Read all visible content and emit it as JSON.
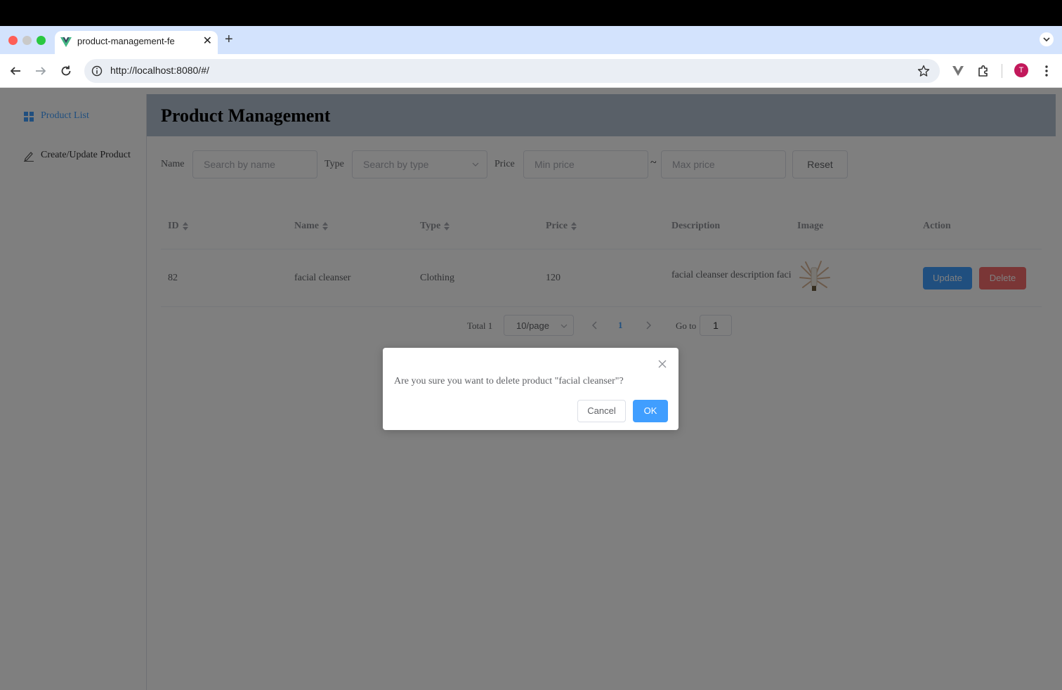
{
  "browser": {
    "tab_title": "product-management-fe",
    "url": "http://localhost:8080/#/",
    "profile_initial": "T"
  },
  "sidebar": {
    "items": [
      {
        "label": "Product List",
        "icon": "grid-icon",
        "active": true
      },
      {
        "label": "Create/Update Product",
        "icon": "edit-icon",
        "active": false
      }
    ]
  },
  "header": {
    "title": "Product Management"
  },
  "filters": {
    "name_label": "Name",
    "name_placeholder": "Search by name",
    "type_label": "Type",
    "type_placeholder": "Search by type",
    "price_label": "Price",
    "min_price_placeholder": "Min price",
    "price_separator": "~",
    "max_price_placeholder": "Max price",
    "reset_label": "Reset"
  },
  "table": {
    "columns": [
      "ID",
      "Name",
      "Type",
      "Price",
      "Description",
      "Image",
      "Action"
    ],
    "rows": [
      {
        "id": "82",
        "name": "facial cleanser",
        "type": "Clothing",
        "price": "120",
        "description": "facial cleanser description faci",
        "update_label": "Update",
        "delete_label": "Delete"
      }
    ]
  },
  "pagination": {
    "total_text": "Total 1",
    "page_size": "10/page",
    "current_page": "1",
    "goto_label": "Go to",
    "goto_value": "1"
  },
  "dialog": {
    "message": "Are you sure you want to delete product \"facial cleanser\"?",
    "cancel_label": "Cancel",
    "ok_label": "OK"
  },
  "colors": {
    "primary": "#409eff",
    "danger": "#f56c6c",
    "header_bg": "#b3c0d1",
    "profile": "#c2185b"
  }
}
